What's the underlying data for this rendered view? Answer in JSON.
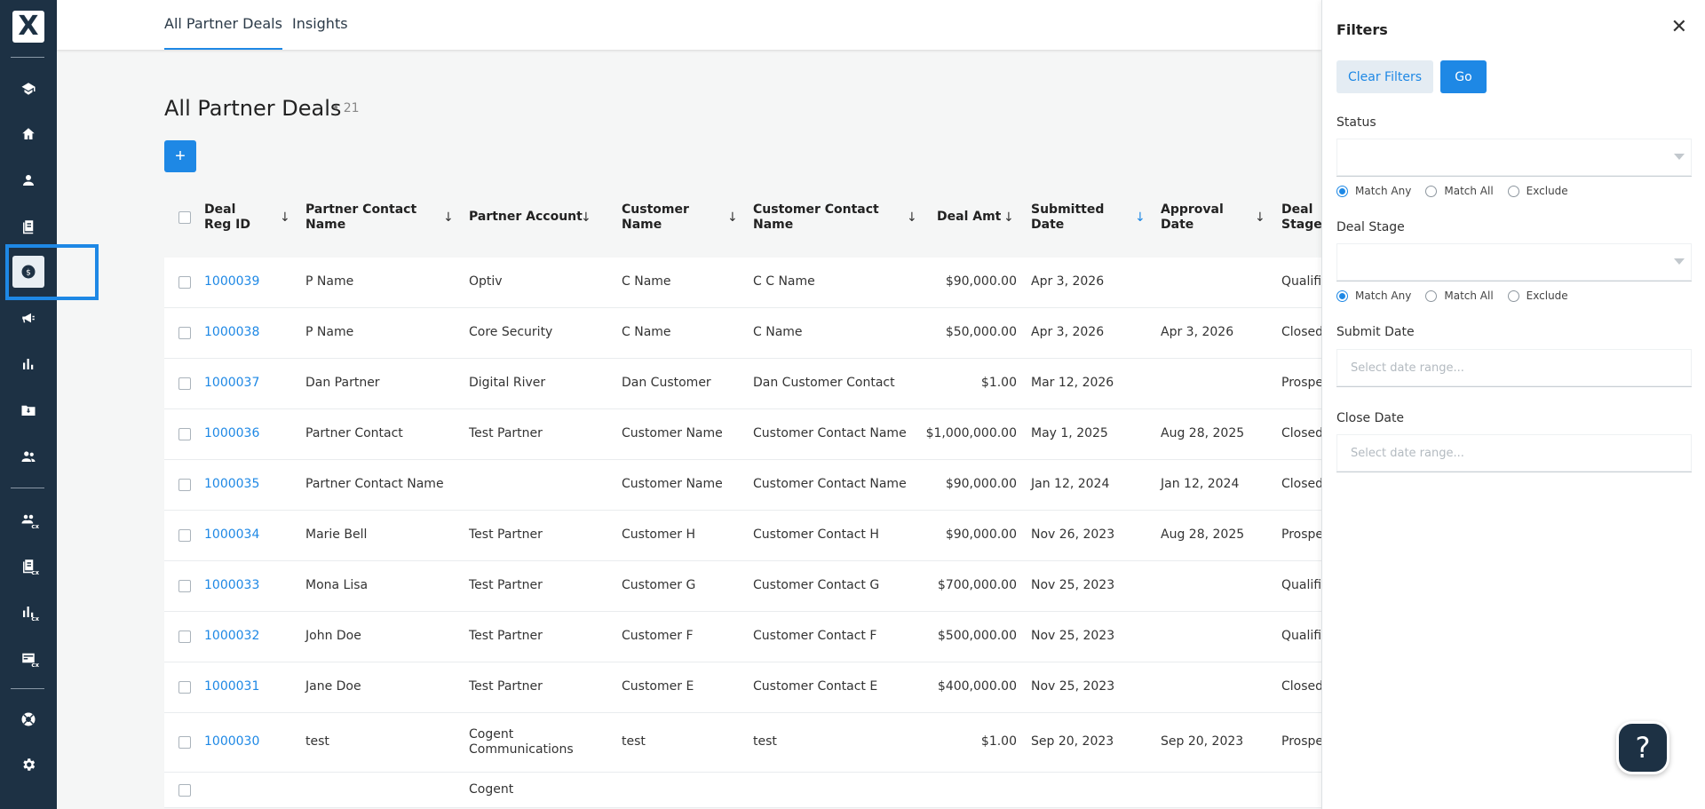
{
  "app": {
    "logo_icon": "logo-x-icon",
    "accent": "#1e88e5",
    "sidebar_bg": "#1d3144"
  },
  "topbar": {
    "tabs": [
      {
        "label": "All Partner Deals",
        "active": true
      },
      {
        "label": "Insights",
        "active": false
      }
    ]
  },
  "page": {
    "title": "All Partner Deals",
    "count": "• 21",
    "add_label": "+"
  },
  "sidebar": {
    "items": [
      {
        "icon": "school-icon"
      },
      {
        "icon": "home-icon"
      },
      {
        "icon": "user-icon"
      },
      {
        "icon": "library-icon"
      },
      {
        "icon": "dollar-icon",
        "active": true
      },
      {
        "icon": "megaphone-icon"
      },
      {
        "icon": "bar-chart-icon"
      },
      {
        "icon": "folder-download-icon"
      },
      {
        "icon": "people-icon"
      },
      {
        "icon": "people-cx-icon",
        "badge": "cx"
      },
      {
        "icon": "library-cx-icon",
        "badge": "cx"
      },
      {
        "icon": "bar-chart-cx-icon",
        "badge": "cx"
      },
      {
        "icon": "card-cx-icon",
        "badge": "cx"
      },
      {
        "icon": "lifebuoy-icon"
      },
      {
        "icon": "gear-icon"
      }
    ]
  },
  "table": {
    "columns": [
      {
        "label": "Deal Reg ID",
        "sort": "↓"
      },
      {
        "label": "Partner Contact Name",
        "sort": "↓"
      },
      {
        "label": "Partner Account",
        "sort": "↓"
      },
      {
        "label": "Customer Name",
        "sort": "↓"
      },
      {
        "label": "Customer Contact Name",
        "sort": "↓"
      },
      {
        "label": "Deal Amt",
        "sort": "↓"
      },
      {
        "label": "Submitted Date",
        "sort": "↓"
      },
      {
        "label": "Approval Date",
        "sort": "↓"
      },
      {
        "label": "Deal Stage",
        "sort": ""
      }
    ],
    "rows": [
      {
        "id": "1000039",
        "partner_contact": "P Name",
        "partner_account": "Optiv",
        "customer": "C Name",
        "customer_contact": "C C Name",
        "amount": "$90,000.00",
        "submitted": "Apr 3, 2026",
        "approval": "",
        "stage": "Qualific"
      },
      {
        "id": "1000038",
        "partner_contact": "P Name",
        "partner_account": "Core Security",
        "customer": "C Name",
        "customer_contact": "C Name",
        "amount": "$50,000.00",
        "submitted": "Apr 3, 2026",
        "approval": "Apr 3, 2026",
        "stage": "Closed"
      },
      {
        "id": "1000037",
        "partner_contact": "Dan Partner",
        "partner_account": "Digital River",
        "customer": "Dan Customer",
        "customer_contact": "Dan Customer Contact",
        "amount": "$1.00",
        "submitted": "Mar 12, 2026",
        "approval": "",
        "stage": "Prospe"
      },
      {
        "id": "1000036",
        "partner_contact": "Partner Contact",
        "partner_account": "Test Partner",
        "customer": "Customer Name",
        "customer_contact": "Customer Contact Name",
        "amount": "$1,000,000.00",
        "submitted": "May 1, 2025",
        "approval": "Aug 28, 2025",
        "stage": "Closed"
      },
      {
        "id": "1000035",
        "partner_contact": "Partner Contact Name",
        "partner_account": "",
        "customer": "Customer Name",
        "customer_contact": "Customer Contact Name",
        "amount": "$90,000.00",
        "submitted": "Jan 12, 2024",
        "approval": "Jan 12, 2024",
        "stage": "Closed"
      },
      {
        "id": "1000034",
        "partner_contact": "Marie Bell",
        "partner_account": "Test Partner",
        "customer": "Customer H",
        "customer_contact": "Customer Contact H",
        "amount": "$90,000.00",
        "submitted": "Nov 26, 2023",
        "approval": "Aug 28, 2025",
        "stage": "Prospe"
      },
      {
        "id": "1000033",
        "partner_contact": "Mona Lisa",
        "partner_account": "Test Partner",
        "customer": "Customer G",
        "customer_contact": "Customer Contact G",
        "amount": "$700,000.00",
        "submitted": "Nov 25, 2023",
        "approval": "",
        "stage": "Qualific"
      },
      {
        "id": "1000032",
        "partner_contact": "John Doe",
        "partner_account": "Test Partner",
        "customer": "Customer F",
        "customer_contact": "Customer Contact F",
        "amount": "$500,000.00",
        "submitted": "Nov 25, 2023",
        "approval": "",
        "stage": "Qualific"
      },
      {
        "id": "1000031",
        "partner_contact": "Jane Doe",
        "partner_account": "Test Partner",
        "customer": "Customer E",
        "customer_contact": "Customer Contact E",
        "amount": "$400,000.00",
        "submitted": "Nov 25, 2023",
        "approval": "",
        "stage": "Closed"
      },
      {
        "id": "1000030",
        "partner_contact": "test",
        "partner_account": "Cogent Communications",
        "customer": "test",
        "customer_contact": "test",
        "amount": "$1.00",
        "submitted": "Sep 20, 2023",
        "approval": "Sep 20, 2023",
        "stage": "Prospe"
      },
      {
        "id": "",
        "partner_contact": "",
        "partner_account": "Cogent",
        "customer": "",
        "customer_contact": "",
        "amount": "",
        "submitted": "",
        "approval": "",
        "stage": ""
      }
    ]
  },
  "filters": {
    "title": "Filters",
    "close_icon": "close-icon",
    "clear_label": "Clear Filters",
    "go_label": "Go",
    "status_label": "Status",
    "deal_stage_label": "Deal Stage",
    "match_options": [
      "Match Any",
      "Match All",
      "Exclude"
    ],
    "submit_date_label": "Submit Date",
    "close_date_label": "Close Date",
    "date_placeholder": "Select date range..."
  },
  "help": {
    "label": "?"
  }
}
